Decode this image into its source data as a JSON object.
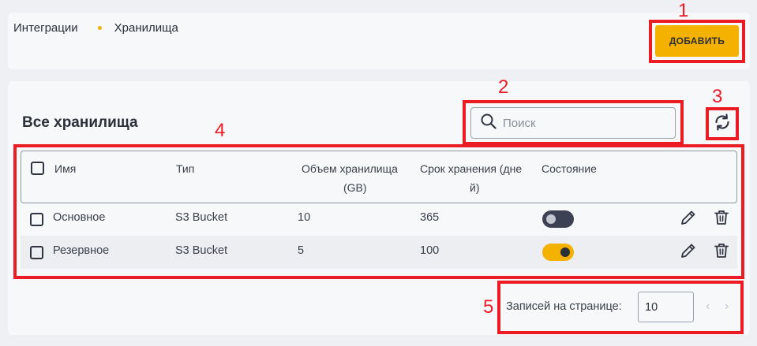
{
  "breadcrumb": {
    "parent": "Интеграции",
    "current": "Хранилища"
  },
  "header": {
    "add_label": "ДОБАВИТЬ"
  },
  "section": {
    "title": "Все хранилища"
  },
  "search": {
    "placeholder": "Поиск"
  },
  "table": {
    "columns": {
      "name": "Имя",
      "type": "Тип",
      "size_line1": "Объем хранилища",
      "size_line2": "(GB)",
      "retention_line1": "Срок хранения (дне",
      "retention_line2": "й)",
      "state": "Состояние"
    },
    "rows": [
      {
        "name": "Основное",
        "type": "S3 Bucket",
        "size": "10",
        "retention": "365",
        "enabled": false
      },
      {
        "name": "Резервное",
        "type": "S3 Bucket",
        "size": "5",
        "retention": "100",
        "enabled": true
      }
    ]
  },
  "pagination": {
    "label": "Записей на странице:",
    "per_page": "10",
    "prev_icon": "chevron-left-icon",
    "next_icon": "chevron-right-icon"
  },
  "annotations": [
    "1",
    "2",
    "3",
    "4",
    "5"
  ],
  "colors": {
    "accent": "#f5b100",
    "annotation": "#ec1c24",
    "toggle_off": "#3c4253"
  }
}
